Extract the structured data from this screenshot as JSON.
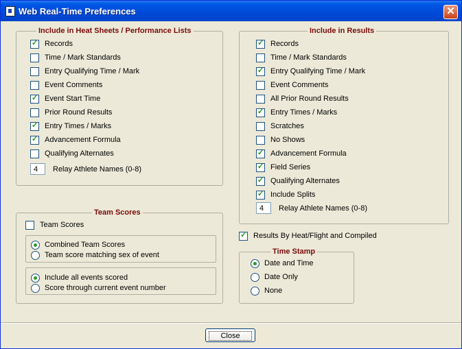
{
  "window": {
    "title": "Web Real-Time Preferences"
  },
  "heat_sheets": {
    "title": "Include in Heat Sheets / Performance Lists",
    "items": [
      {
        "label": "Records",
        "checked": true
      },
      {
        "label": "Time / Mark Standards",
        "checked": false
      },
      {
        "label": "Entry Qualifying Time / Mark",
        "checked": false
      },
      {
        "label": "Event Comments",
        "checked": false
      },
      {
        "label": "Event Start Time",
        "checked": true
      },
      {
        "label": "Prior Round Results",
        "checked": false
      },
      {
        "label": "Entry Times / Marks",
        "checked": true
      },
      {
        "label": "Advancement Formula",
        "checked": true
      },
      {
        "label": "Qualifying Alternates",
        "checked": false
      }
    ],
    "relay_value": "4",
    "relay_label": "Relay Athlete Names (0-8)"
  },
  "results": {
    "title": "Include in Results",
    "items": [
      {
        "label": "Records",
        "checked": true
      },
      {
        "label": "Time / Mark Standards",
        "checked": false
      },
      {
        "label": "Entry Qualifying Time / Mark",
        "checked": true
      },
      {
        "label": "Event Comments",
        "checked": false
      },
      {
        "label": "All Prior Round Results",
        "checked": false
      },
      {
        "label": "Entry Times / Marks",
        "checked": true
      },
      {
        "label": "Scratches",
        "checked": false
      },
      {
        "label": "No Shows",
        "checked": false
      },
      {
        "label": "Advancement Formula",
        "checked": true
      },
      {
        "label": "Field Series",
        "checked": true
      },
      {
        "label": "Qualifying Alternates",
        "checked": true
      },
      {
        "label": "Include Splits",
        "checked": true
      }
    ],
    "relay_value": "4",
    "relay_label": "Relay Athlete Names (0-8)"
  },
  "team_scores": {
    "title": "Team Scores",
    "checkbox_label": "Team Scores",
    "checked": false,
    "scoring_options": [
      {
        "label": "Combined Team Scores",
        "selected": true
      },
      {
        "label": "Team score matching sex of event",
        "selected": false
      }
    ],
    "event_options": [
      {
        "label": "Include all events scored",
        "selected": true
      },
      {
        "label": "Score through current event number",
        "selected": false
      }
    ]
  },
  "results_by_heat": {
    "label": "Results By Heat/Flight and Compiled",
    "checked": true
  },
  "time_stamp": {
    "title": "Time Stamp",
    "options": [
      {
        "label": "Date and Time",
        "selected": true
      },
      {
        "label": "Date Only",
        "selected": false
      },
      {
        "label": "None",
        "selected": false
      }
    ]
  },
  "footer": {
    "close_label": "Close"
  }
}
